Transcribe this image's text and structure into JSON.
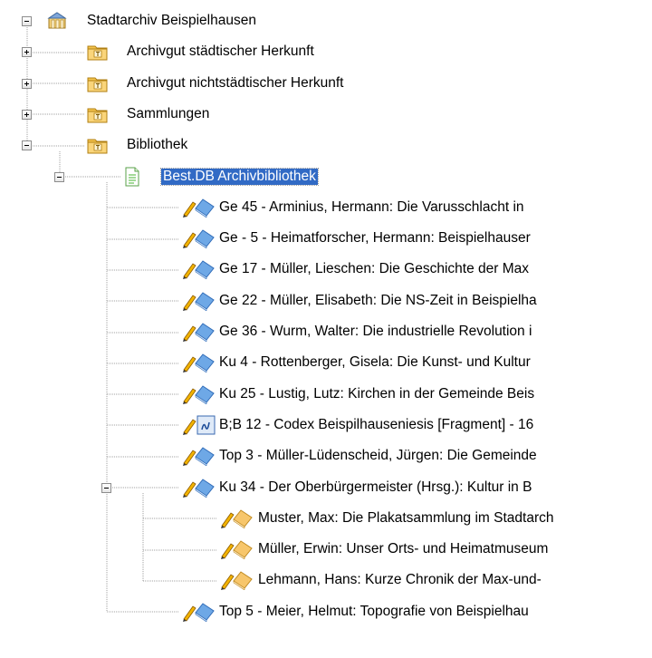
{
  "tree": {
    "root": {
      "label": "Stadtarchiv Beispielhausen",
      "icon": "archive-building-icon",
      "expanded": true
    },
    "rows": [
      {
        "level": 1,
        "label": "Archivgut städtischer Herkunft",
        "icon": "tektonik-folder-icon",
        "expander": "plus"
      },
      {
        "level": 1,
        "label": "Archivgut nichtstädtischer Herkunft",
        "icon": "tektonik-folder-icon",
        "expander": "plus"
      },
      {
        "level": 1,
        "label": "Sammlungen",
        "icon": "tektonik-folder-icon",
        "expander": "plus"
      },
      {
        "level": 1,
        "label": "Bibliothek",
        "icon": "tektonik-folder-icon",
        "expander": "minus"
      },
      {
        "level": 2,
        "label": "Best.DB Archivbibliothek",
        "icon": "database-document-icon",
        "expander": "minus",
        "selected": true
      },
      {
        "level": 3,
        "label": "Ge 45 - Arminius, Hermann: Die Varusschlacht in",
        "icon": "book-icon"
      },
      {
        "level": 3,
        "label": "Ge - 5 - Heimatforscher, Hermann: Beispielhauser",
        "icon": "book-icon"
      },
      {
        "level": 3,
        "label": "Ge 17 - Müller, Lieschen: Die Geschichte der Max",
        "icon": "book-icon"
      },
      {
        "level": 3,
        "label": "Ge 22 - Müller, Elisabeth: Die NS-Zeit in Beispielha",
        "icon": "book-icon"
      },
      {
        "level": 3,
        "label": "Ge 36 - Wurm, Walter: Die industrielle Revolution i",
        "icon": "book-icon"
      },
      {
        "level": 3,
        "label": "Ku 4 - Rottenberger, Gisela: Die Kunst- und Kultur",
        "icon": "book-icon"
      },
      {
        "level": 3,
        "label": "Ku 25 - Lustig, Lutz: Kirchen in der Gemeinde Beis",
        "icon": "book-icon"
      },
      {
        "level": 3,
        "label": "B;B 12 - Codex Beispilhauseniesis [Fragment] - 16",
        "icon": "manuscript-icon"
      },
      {
        "level": 3,
        "label": "Top 3 - Müller-Lüdenscheid, Jürgen: Die Gemeinde",
        "icon": "book-icon"
      },
      {
        "level": 3,
        "label": "Ku 34 - Der Oberbürgermeister (Hrsg.): Kultur in B",
        "icon": "book-icon",
        "expander": "minus"
      },
      {
        "level": 4,
        "label": "Muster, Max: Die Plakatsammlung im Stadtarch",
        "icon": "article-icon"
      },
      {
        "level": 4,
        "label": "Müller, Erwin: Unser Orts- und Heimatmuseum",
        "icon": "article-icon"
      },
      {
        "level": 4,
        "label": "Lehmann, Hans: Kurze Chronik der Max-und-",
        "icon": "article-icon"
      },
      {
        "level": 3,
        "label": "Top 5 - Meier, Helmut: Topografie von Beispielhau",
        "icon": "book-icon"
      }
    ]
  },
  "colors": {
    "selection": "#316ac5",
    "tree_line": "#a0a0a0",
    "folder": "#f5c44e",
    "book": "#6ea8e6",
    "article": "#f7c66b",
    "pencil": "#f2b300"
  }
}
